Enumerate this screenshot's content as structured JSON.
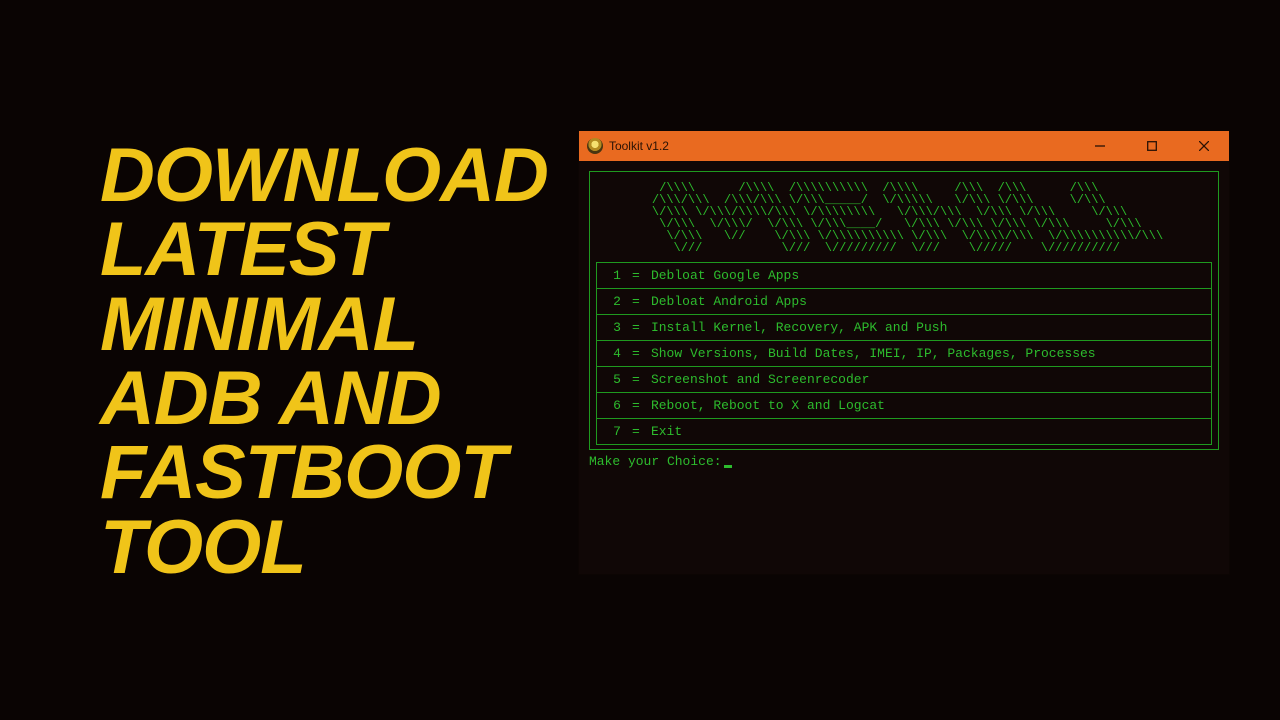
{
  "headline": "DOWNLOAD\nLATEST\nMINIMAL\nADB AND\nFASTBOOT\nTOOL",
  "window": {
    "title": "Toolkit v1.2",
    "ascii": "  /\\\\\\\\      /\\\\\\\\  /\\\\\\\\\\\\\\\\\\\\  /\\\\\\\\     /\\\\\\  /\\\\\\      /\\\\\\\n /\\\\\\/\\\\\\  /\\\\\\/\\\\\\ \\/\\\\\\_____/  \\/\\\\\\\\\\   \\/\\\\\\ \\/\\\\\\     \\/\\\\\\\n \\/\\\\\\ \\/\\\\\\/\\\\\\\\/\\\\\\ \\/\\\\\\\\\\\\\\\\   \\/\\\\\\/\\\\\\  \\/\\\\\\ \\/\\\\\\     \\/\\\\\\\n  \\/\\\\\\  \\/\\\\\\/  \\/\\\\\\ \\/\\\\\\____/   \\/\\\\\\ \\/\\\\\\ \\/\\\\\\ \\/\\\\\\     \\/\\\\\\\n   \\/\\\\\\   \\//    \\/\\\\\\ \\/\\\\\\\\\\\\\\\\\\\\ \\/\\\\\\  \\/\\\\\\\\/\\\\\\  \\/\\\\\\\\\\\\\\\\\\\\/\\\\\\\n    \\///           \\///  \\/////////  \\///    \\/////    \\//////////",
    "menu": [
      {
        "num": "1",
        "label": "Debloat Google Apps"
      },
      {
        "num": "2",
        "label": "Debloat Android Apps"
      },
      {
        "num": "3",
        "label": "Install Kernel, Recovery, APK and Push"
      },
      {
        "num": "4",
        "label": "Show Versions, Build Dates, IMEI, IP, Packages, Processes"
      },
      {
        "num": "5",
        "label": "Screenshot and Screenrecoder"
      },
      {
        "num": "6",
        "label": "Reboot, Reboot to X and Logcat"
      },
      {
        "num": "7",
        "label": "Exit"
      }
    ],
    "prompt": "Make your Choice:"
  }
}
